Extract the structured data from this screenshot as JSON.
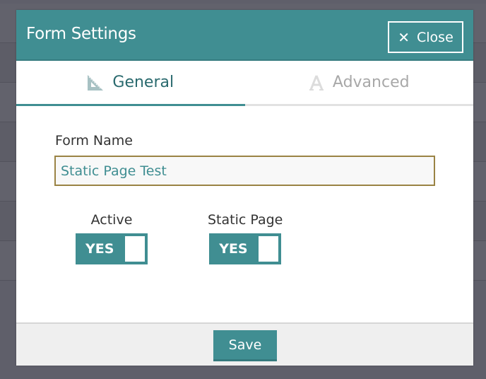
{
  "modal": {
    "title": "Form Settings",
    "close_label": "Close"
  },
  "tabs": [
    {
      "label": "General",
      "icon": "set-square-icon",
      "active": true
    },
    {
      "label": "Advanced",
      "icon": "letter-a-icon",
      "active": false
    }
  ],
  "form": {
    "name_label": "Form Name",
    "name_value": "Static Page Test",
    "toggles": [
      {
        "label": "Active",
        "state": "YES"
      },
      {
        "label": "Static Page",
        "state": "YES"
      }
    ]
  },
  "footer": {
    "save_label": "Save"
  },
  "colors": {
    "accent": "#408e92",
    "input_border": "#9a8344",
    "overlay": "#5f5f6a"
  }
}
